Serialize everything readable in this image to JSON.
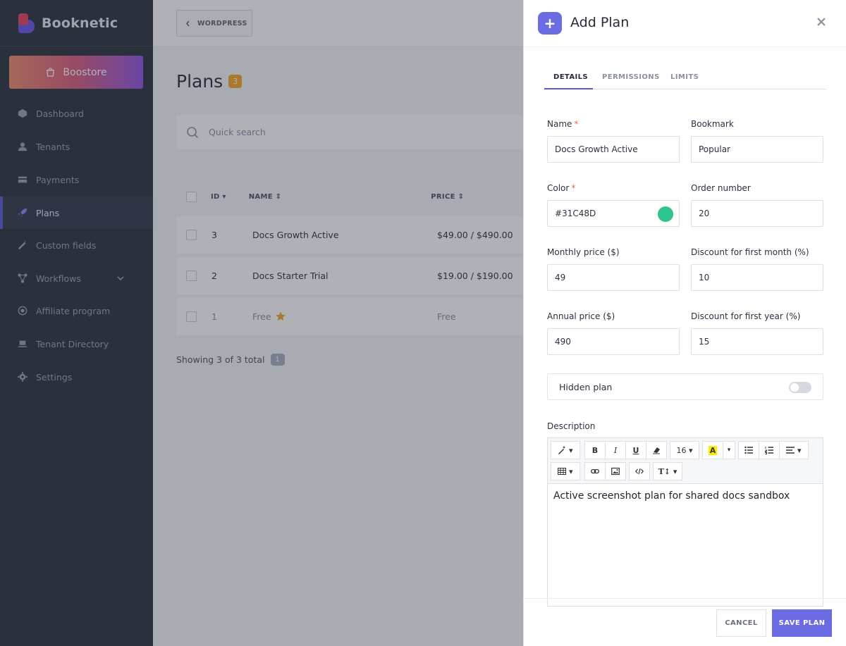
{
  "sidebar": {
    "brand": "Booknetic",
    "boostore_label": "Boostore",
    "items": [
      {
        "label": "Dashboard"
      },
      {
        "label": "Tenants"
      },
      {
        "label": "Payments"
      },
      {
        "label": "Plans",
        "active": true
      },
      {
        "label": "Custom fields"
      },
      {
        "label": "Workflows"
      },
      {
        "label": "Affiliate program"
      },
      {
        "label": "Tenant Directory"
      },
      {
        "label": "Settings"
      }
    ]
  },
  "topbar": {
    "wordpress_label": "WORDPRESS"
  },
  "plans": {
    "title": "Plans",
    "count": "3",
    "search_placeholder": "Quick search",
    "columns": {
      "id": "ID",
      "name": "NAME",
      "price": "PRICE"
    },
    "rows": [
      {
        "id": "3",
        "name": "Docs Growth Active",
        "price": "$49.00 / $490.00"
      },
      {
        "id": "2",
        "name": "Docs Starter Trial",
        "price": "$19.00 / $190.00"
      },
      {
        "id": "1",
        "name": "Free",
        "price": "Free"
      }
    ],
    "footer_text": "Showing 3 of 3 total",
    "page": "1"
  },
  "panel": {
    "title": "Add Plan",
    "tabs": [
      "DETAILS",
      "PERMISSIONS",
      "LIMITS"
    ],
    "fields": {
      "name": {
        "label": "Name",
        "value": "Docs Growth Active"
      },
      "bookmark": {
        "label": "Bookmark",
        "value": "Popular"
      },
      "color": {
        "label": "Color",
        "value": "#31C48D"
      },
      "order": {
        "label": "Order number",
        "value": "20"
      },
      "monthly": {
        "label": "Monthly price ($)",
        "value": "49"
      },
      "discount_month": {
        "label": "Discount for first month (%)",
        "value": "10"
      },
      "annual": {
        "label": "Annual price ($)",
        "value": "490"
      },
      "discount_year": {
        "label": "Discount for first year (%)",
        "value": "15"
      }
    },
    "hidden_plan_label": "Hidden plan",
    "hidden_plan_on": false,
    "description_label": "Description",
    "editor": {
      "font_size": "16",
      "content": "Active screenshot plan for shared docs sandbox"
    },
    "cancel_label": "CANCEL",
    "save_label": "SAVE PLAN"
  },
  "colors": {
    "accent": "#6c6ce2",
    "plan_color": "#31C48D",
    "count_badge": "#f5a623",
    "sidebar_bg": "#2b2f3d"
  }
}
